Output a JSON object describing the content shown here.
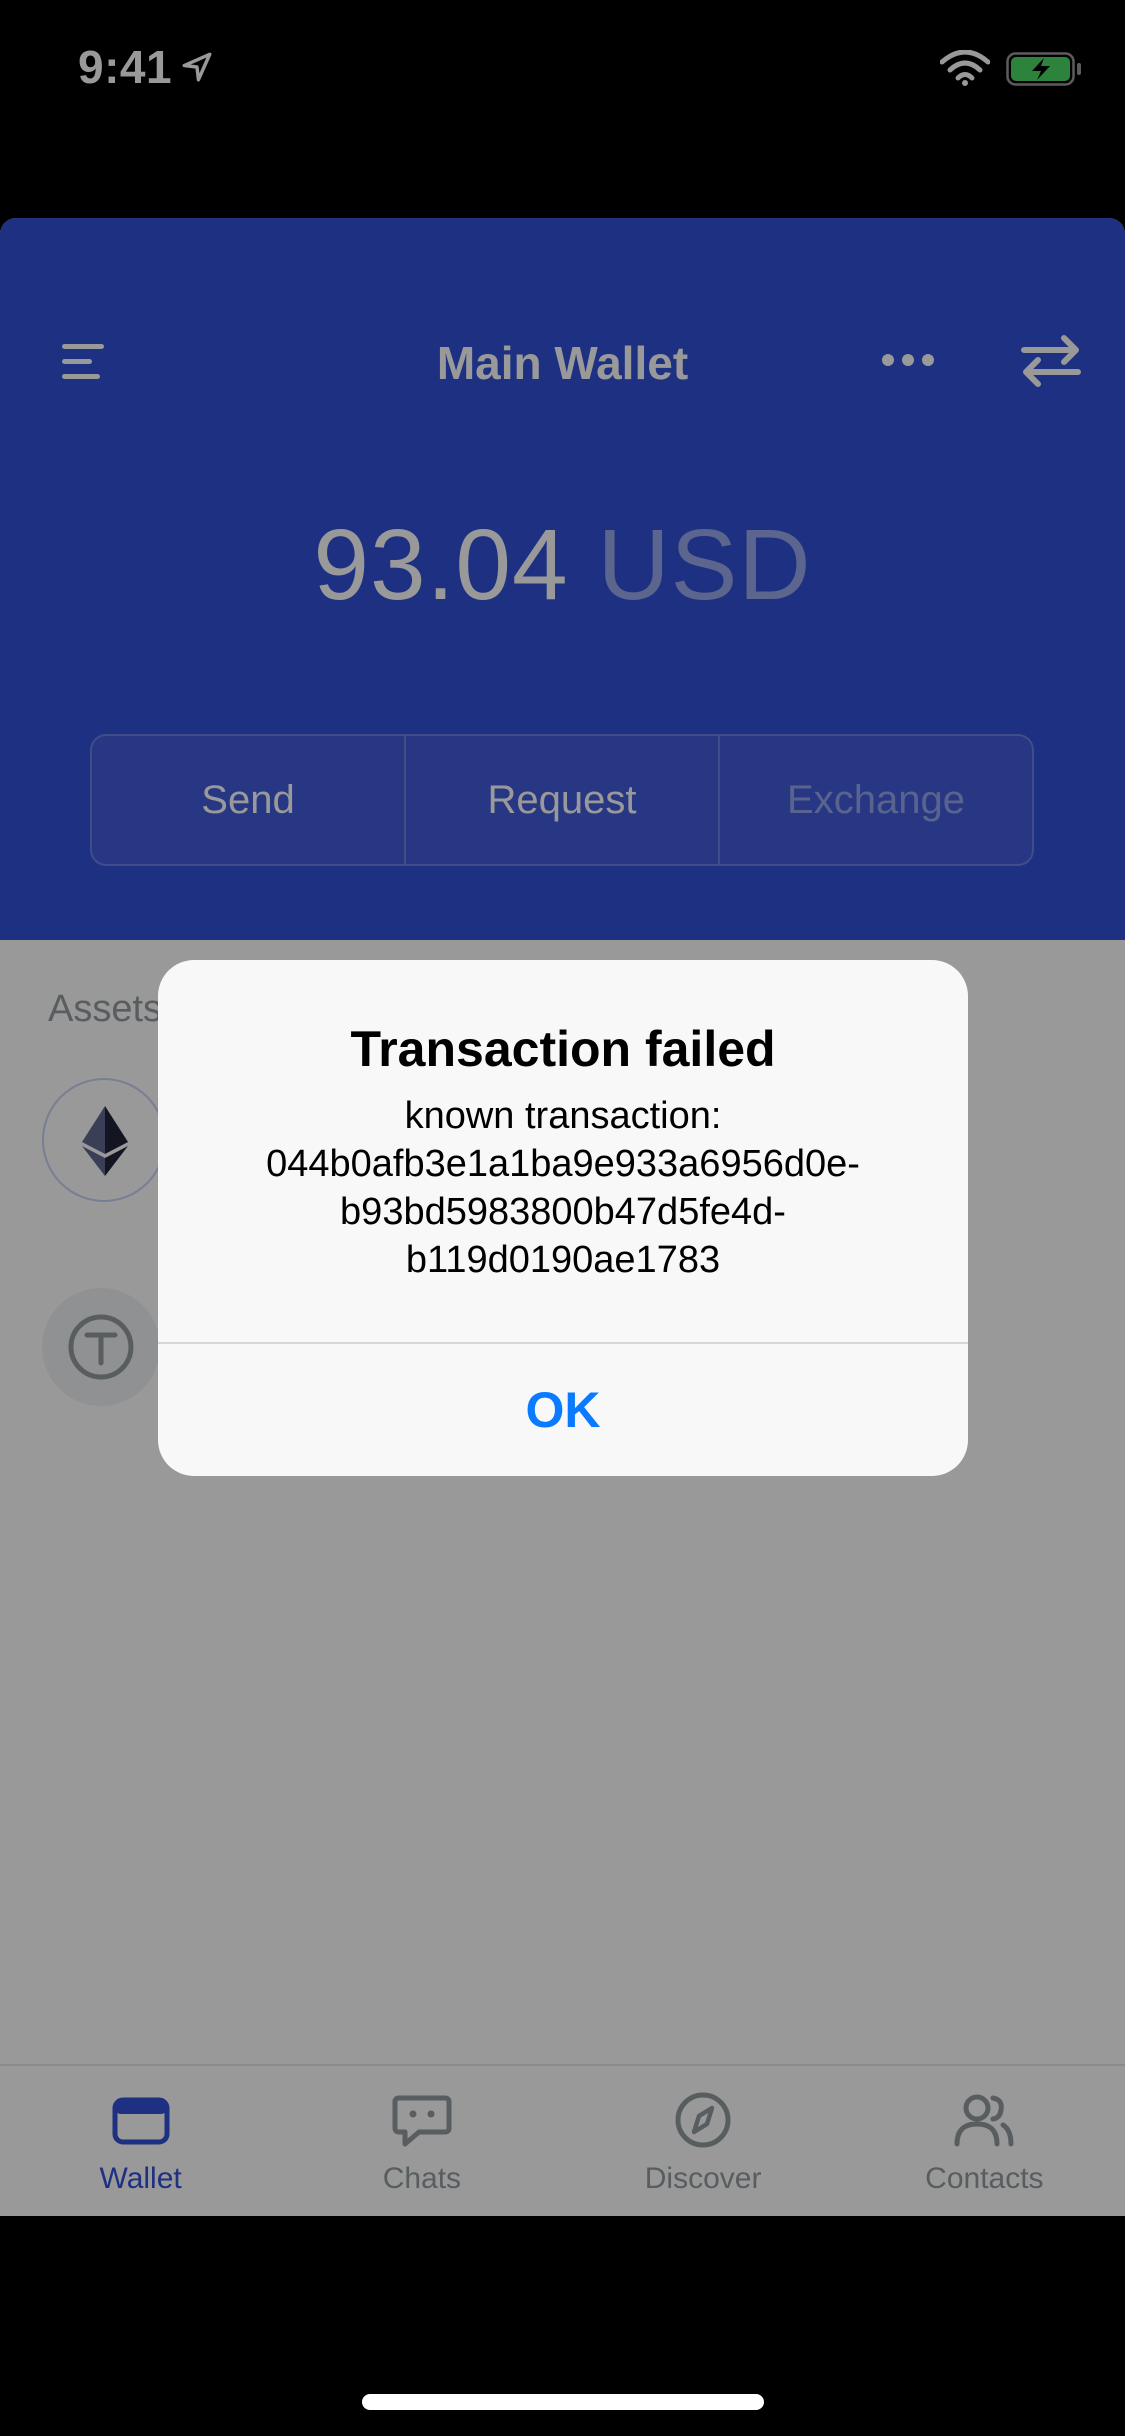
{
  "status_bar": {
    "time": "9:41"
  },
  "header": {
    "title": "Main Wallet",
    "balance_value": "93.04",
    "balance_currency": "USD",
    "actions": {
      "send": "Send",
      "request": "Request",
      "exchange": "Exchange"
    }
  },
  "assets": {
    "label": "Assets"
  },
  "tabs": {
    "wallet": "Wallet",
    "chats": "Chats",
    "discover": "Discover",
    "contacts": "Contacts"
  },
  "alert": {
    "title": "Transaction failed",
    "message_line1": "known transaction:",
    "message_line2": "044b0afb3e1a1ba9e933a6956d0e-",
    "message_line3": "b93bd5983800b47d5fe4d-",
    "message_line4": "b119d0190ae1783",
    "ok_label": "OK"
  },
  "colors": {
    "brand_blue": "#3250d9",
    "ios_link_blue": "#0a7aff",
    "muted_gray": "#939ba1"
  }
}
